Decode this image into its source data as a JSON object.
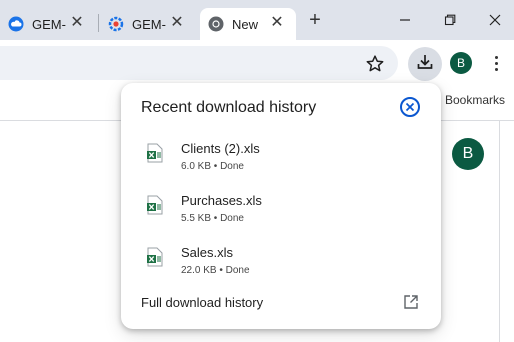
{
  "tabs": [
    {
      "title": "GEM-",
      "icon": "cloud-icon"
    },
    {
      "title": "GEM-",
      "icon": "gear-icon"
    },
    {
      "title": "New",
      "icon": "chrome-icon",
      "active": true
    }
  ],
  "toolbar": {
    "profile_initial": "B"
  },
  "bookmarks_bar": {
    "label": "Bookmarks"
  },
  "page": {
    "avatar_initial": "B"
  },
  "download_popup": {
    "title": "Recent download history",
    "items": [
      {
        "name": "Clients (2).xls",
        "size": "6.0 KB",
        "status": "Done",
        "meta": "6.0 KB • Done"
      },
      {
        "name": "Purchases.xls",
        "size": "5.5 KB",
        "status": "Done",
        "meta": "5.5 KB • Done"
      },
      {
        "name": "Sales.xls",
        "size": "22.0 KB",
        "status": "Done",
        "meta": "22.0 KB • Done"
      }
    ],
    "full_history_label": "Full download history"
  },
  "colors": {
    "accent_blue": "#0b57d0",
    "avatar_green": "#0b5a42",
    "excel_green": "#1e7145",
    "tabstrip_bg": "#dfe3eb"
  }
}
